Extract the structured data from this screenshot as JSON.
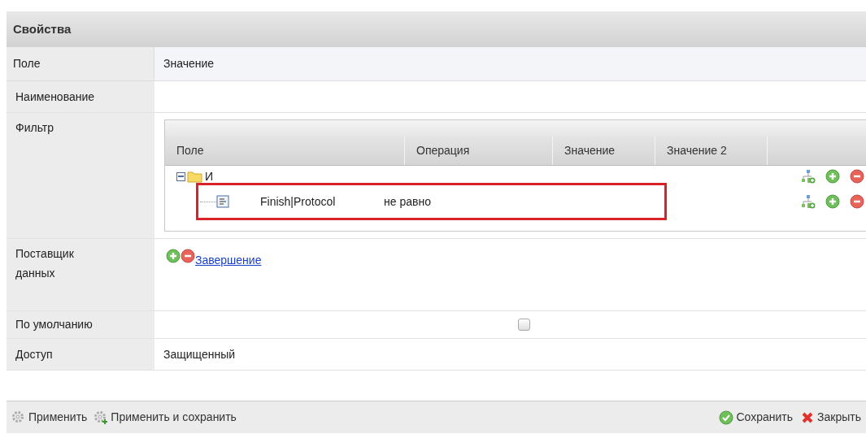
{
  "panel": {
    "title": "Свойства"
  },
  "properties": {
    "columns": [
      "Поле",
      "Значение"
    ],
    "rows": [
      {
        "kind": "text",
        "label": "Наименование",
        "value": ""
      },
      {
        "kind": "filter",
        "label": "Фильтр"
      },
      {
        "kind": "provider",
        "label": "Поставщик данных",
        "link": "Завершение"
      },
      {
        "kind": "checkbox",
        "label": "По умолчанию",
        "checked": false
      },
      {
        "kind": "text",
        "label": "Доступ",
        "value": "Защищенный"
      }
    ]
  },
  "filter": {
    "columns": [
      "Поле",
      "Операция",
      "Значение",
      "Значение 2"
    ],
    "tree": [
      {
        "kind": "group",
        "label": "И",
        "expanded": true,
        "children": [
          {
            "kind": "condition",
            "field": "Finish|Protocol",
            "operation": "не равно",
            "highlighted": true
          }
        ]
      }
    ]
  },
  "toolbar": {
    "left": [
      "Применить",
      "Применить и сохранить"
    ],
    "right": [
      {
        "kind": "save",
        "label": "Сохранить"
      },
      {
        "kind": "close",
        "label": "Закрыть"
      }
    ]
  }
}
